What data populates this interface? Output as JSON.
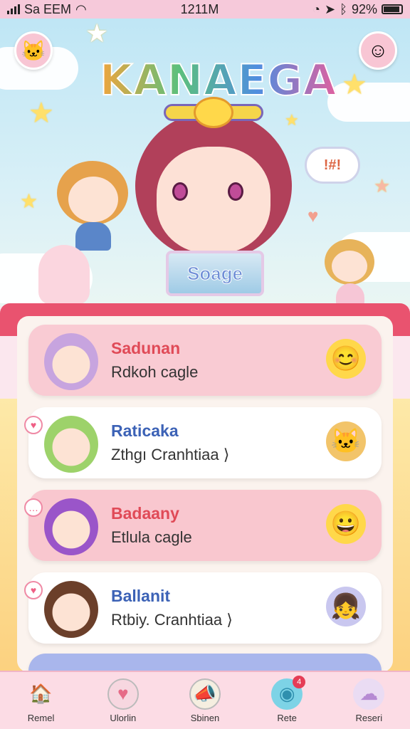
{
  "status_bar": {
    "carrier": "Sa EEM",
    "time": "1211M",
    "battery": "92%"
  },
  "header": {
    "logo": "KANAEGA"
  },
  "hero": {
    "bubble_text": "!#!",
    "plate_text": "Soage"
  },
  "cards": [
    {
      "title": "Sadunan",
      "subtitle": "Rdkoh cagle",
      "bg": "#f9cbd3",
      "title_color": "#e04a57",
      "deco_icon": "smiley-icon",
      "deco_glyph": "😊"
    },
    {
      "title": "Raticaka",
      "subtitle": "Zthgı Cranhtiaa ⟩",
      "bg": "#ffffff",
      "title_color": "#3c62b6",
      "deco_icon": "cat-icon",
      "deco_glyph": "🐱"
    },
    {
      "title": "Badaany",
      "subtitle": "Etlula cagle",
      "bg": "#f9c7cf",
      "title_color": "#e04a57",
      "deco_icon": "grin-icon",
      "deco_glyph": "😀"
    },
    {
      "title": "Ballanit",
      "subtitle": "Rtbiy. Cranhtiaa ⟩",
      "bg": "#ffffff",
      "title_color": "#3c62b6",
      "deco_icon": "girl-icon",
      "deco_glyph": "👧"
    }
  ],
  "nav": [
    {
      "label": "Remel",
      "icon": "house-icon",
      "glyph": "🏠"
    },
    {
      "label": "Ulorlin",
      "icon": "heart-icon",
      "glyph": "♥"
    },
    {
      "label": "Sbinen",
      "icon": "megaphone-icon",
      "glyph": "📣"
    },
    {
      "label": "Rete",
      "icon": "creature-icon",
      "glyph": "◉",
      "badge": "4"
    },
    {
      "label": "Reseri",
      "icon": "face-icon",
      "glyph": "☁"
    }
  ]
}
